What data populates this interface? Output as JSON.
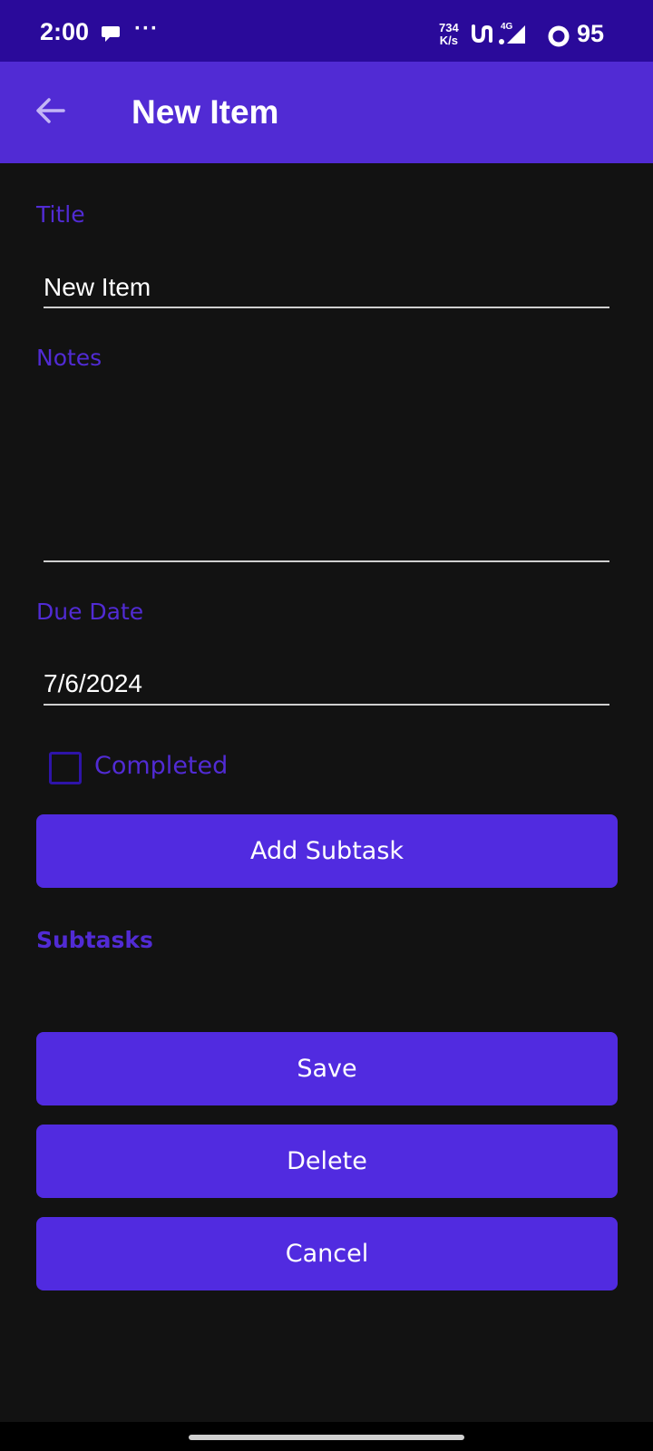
{
  "status_bar": {
    "time": "2:00",
    "dots": "···",
    "speed_value": "734",
    "speed_unit": "K/s",
    "network": "4G",
    "battery": "95"
  },
  "app_bar": {
    "back_icon": "arrow-left-icon",
    "title": "New Item"
  },
  "form": {
    "title_label": "Title",
    "title_value": "New Item",
    "notes_label": "Notes",
    "notes_value": "",
    "due_date_label": "Due Date",
    "due_date_value": "7/6/2024",
    "completed_label": "Completed",
    "completed_checked": false,
    "add_subtask_label": "Add Subtask",
    "subtasks_label": "Subtasks",
    "save_label": "Save",
    "delete_label": "Delete",
    "cancel_label": "Cancel"
  },
  "colors": {
    "accent": "#512bd4",
    "status_bar": "#2a0a9a",
    "background": "#121212"
  }
}
